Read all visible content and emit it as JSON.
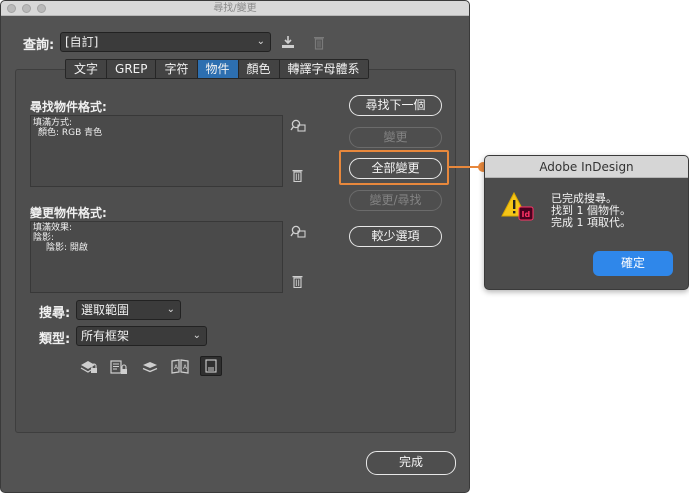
{
  "window": {
    "title": "尋找/變更"
  },
  "query": {
    "label": "查詢:",
    "value": "[自訂]"
  },
  "tabs": [
    {
      "label": "文字"
    },
    {
      "label": "GREP"
    },
    {
      "label": "字符"
    },
    {
      "label": "物件"
    },
    {
      "label": "顏色"
    },
    {
      "label": "轉譯字母體系"
    }
  ],
  "active_tab": "物件",
  "find_format": {
    "label": "尋找物件格式:",
    "line1": "填滿方式:",
    "line2": "顏色: RGB 青色"
  },
  "change_format": {
    "label": "變更物件格式:",
    "line1": "填滿效果:",
    "line2": "陰影:",
    "line3": "陰影: 開啟"
  },
  "buttons": {
    "find_next": "尋找下一個",
    "change": "變更",
    "change_all": "全部變更",
    "change_find": "變更/尋找",
    "fewer_options": "較少選項",
    "done": "完成"
  },
  "search": {
    "label": "搜尋:",
    "value": "選取範圍"
  },
  "type": {
    "label": "類型:",
    "value": "所有框架"
  },
  "alert": {
    "title": "Adobe InDesign",
    "message": "已完成搜尋。\n找到 1 個物件。\n完成 1 項取代。",
    "ok": "確定",
    "app_badge": "Id"
  },
  "colors": {
    "accent": "#e8883c",
    "tab_active": "#2d6fb0",
    "ok_button": "#2f87ea"
  }
}
